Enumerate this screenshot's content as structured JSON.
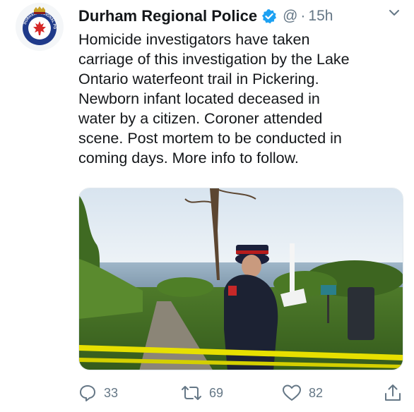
{
  "tweet": {
    "author": {
      "display_name": "Durham Regional Police",
      "handle": "@",
      "verified": true,
      "avatar_icon": "police-badge-icon",
      "avatar_text": "DURHAM REGIONAL POLICE"
    },
    "separator": "·",
    "timestamp": "15h",
    "text": "Homicide investigators have taken\ncarriage of this investigation by the  Lake\nOntario waterfeont trail in Pickering.\nNewborn infant located deceased in\nwater by a citizen. Coroner attended\nscene. Post mortem to be conducted in\ncoming days. More info to follow.",
    "actions": {
      "reply_count": "33",
      "retweet_count": "69",
      "like_count": "82"
    }
  },
  "colors": {
    "verified": "#1da1f2",
    "secondary_text": "#657786",
    "primary_text": "#14171a",
    "police_tape": "#e7e000"
  }
}
